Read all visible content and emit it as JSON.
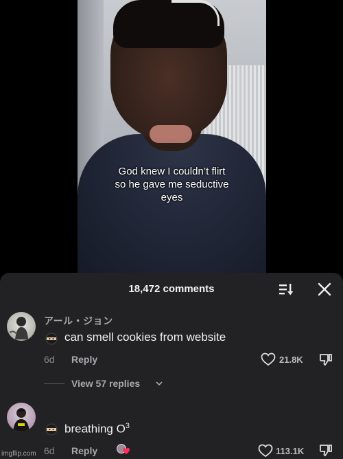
{
  "video": {
    "caption_lines": [
      "God knew I couldn’t flirt",
      "so he gave me seductive",
      "eyes"
    ]
  },
  "comments_header": {
    "count_label": "18,472 comments",
    "sort_icon": "sort-icon",
    "close_icon": "close-icon"
  },
  "comments": [
    {
      "username": "アール・ジョン",
      "text": "can smell cookies from website",
      "age": "6d",
      "reply_label": "Reply",
      "likes": "21.8K",
      "replies_label": "View 57 replies"
    },
    {
      "username": "",
      "text": "breathing O",
      "superscript": "3",
      "age": "6d",
      "reply_label": "Reply",
      "likes": "113.1K"
    }
  ],
  "watermark": "imgflip.com",
  "colors": {
    "panel_bg": "#222224",
    "text_primary": "#f2f2f2",
    "text_secondary": "#8a8a8e"
  }
}
